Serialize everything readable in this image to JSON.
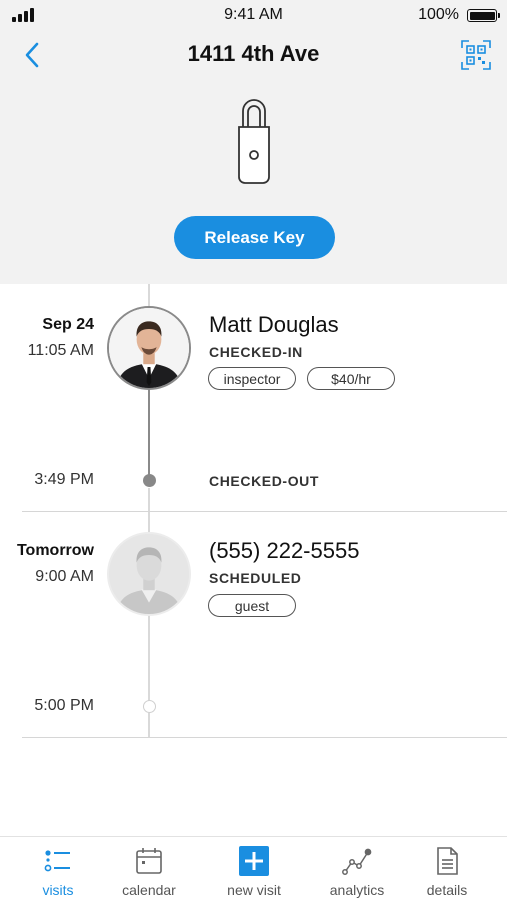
{
  "status_bar": {
    "time": "9:41 AM",
    "battery": "100%"
  },
  "header": {
    "title": "1411 4th Ave",
    "release_label": "Release Key"
  },
  "visits": [
    {
      "date": "Sep 24",
      "start_time": "11:05 AM",
      "end_time": "3:49 PM",
      "name": "Matt Douglas",
      "status": "CHECKED-IN",
      "end_status": "CHECKED-OUT",
      "tags": [
        "inspector",
        "$40/hr"
      ]
    },
    {
      "date": "Tomorrow",
      "start_time": "9:00 AM",
      "end_time": "5:00 PM",
      "name": "(555) 222-5555",
      "status": "SCHEDULED",
      "tags": [
        "guest"
      ]
    }
  ],
  "tabs": [
    {
      "label": "visits",
      "icon": "visits-list-icon",
      "active": true
    },
    {
      "label": "calendar",
      "icon": "calendar-icon"
    },
    {
      "label": "new visit",
      "icon": "plus-icon"
    },
    {
      "label": "analytics",
      "icon": "analytics-icon"
    },
    {
      "label": "details",
      "icon": "document-icon"
    }
  ],
  "colors": {
    "accent": "#1a8ee0",
    "header_bg": "#f2f2f2",
    "timeline_line": "#d9d9d9"
  }
}
